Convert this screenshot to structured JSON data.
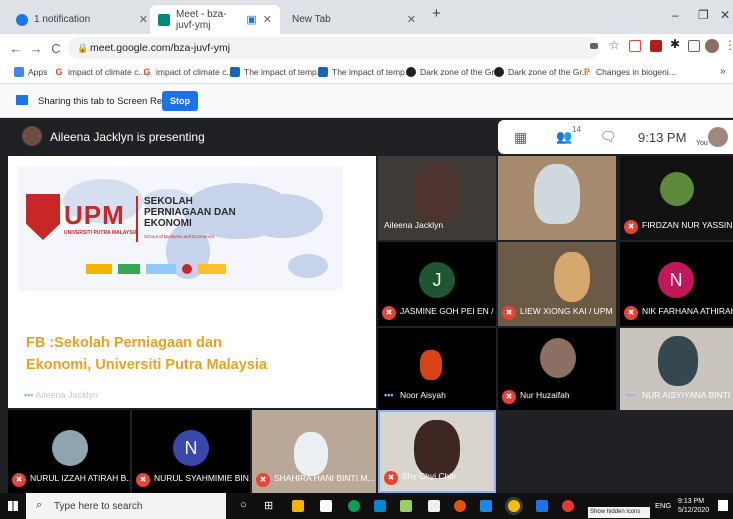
{
  "browser": {
    "tabs": [
      {
        "label": "1 notification",
        "color": "#1a73e8"
      },
      {
        "label": "Meet - bza-juvf-ymj",
        "color": "#00897b",
        "active": true
      },
      {
        "label": "New Tab",
        "color": "#5f6368"
      }
    ],
    "new_tab_glyph": "+",
    "url": "meet.google.com/bza-juvf-ymj",
    "bookmarks": [
      {
        "label": "Apps",
        "icon": "apps-grid-icon",
        "color": "#4285f4"
      },
      {
        "label": "impact of climate c...",
        "icon": "google-icon",
        "color": "#ea4335"
      },
      {
        "label": "impact of climate c...",
        "icon": "google-icon",
        "color": "#ea4335"
      },
      {
        "label": "The impact of temp...",
        "icon": "journal-icon",
        "color": "#1565c0"
      },
      {
        "label": "The impact of temp...",
        "icon": "journal-icon",
        "color": "#1565c0"
      },
      {
        "label": "Dark zone of the Gr...",
        "icon": "dark-icon",
        "color": "#202124"
      },
      {
        "label": "Dark zone of the Gr...",
        "icon": "dark-icon",
        "color": "#202124"
      },
      {
        "label": "Changes in biogeni...",
        "icon": "p-icon",
        "color": "#ff6d00"
      }
    ],
    "more_bookmarks": "»"
  },
  "sharebar": {
    "text": "Sharing this tab to Screen Recorder",
    "stop_label": "Stop"
  },
  "meet": {
    "presenter": "Aileena Jacklyn is presenting",
    "time": "9:13 PM",
    "participant_count": "14",
    "you_label": "You",
    "slide": {
      "school_line1": "SEKOLAH",
      "school_line2": "PERNIAGAAN DAN",
      "school_line3": "EKONOMI",
      "school_en": "School of Business and Economics",
      "upm_text": "UPM",
      "univ_text": "UNIVERSITI PUTRA MALAYSIA",
      "fb_line1": "FB :Sekolah Perniagaan dan",
      "fb_line2": "Ekonomi, Universiti Putra Malaysia",
      "presenter_tag": "Aileena Jacklyn"
    },
    "participants": [
      {
        "name": "Aileena Jacklyn",
        "muted": false
      },
      {
        "name": "",
        "muted": false
      },
      {
        "name": "FIRDZAN NUR YASSIN B...",
        "muted": true
      },
      {
        "name": "JASMINE GOH PEI EN / ...",
        "muted": true,
        "initial": "J",
        "avatar_color": "#1e5631"
      },
      {
        "name": "LIEW XIONG KAI / UPM",
        "muted": true
      },
      {
        "name": "NIK FARHANA ATHIRAH...",
        "muted": true,
        "initial": "N",
        "avatar_color": "#c2185b"
      },
      {
        "name": "Noor Aisyah",
        "muted": false
      },
      {
        "name": "Nur Huzaifah",
        "muted": true
      },
      {
        "name": "NUR AISYIYANA BINTI R...",
        "muted": false
      },
      {
        "name": "NURUL IZZAH ATIRAH B...",
        "muted": true
      },
      {
        "name": "NURUL SYAHMIMIE BIN...",
        "muted": true,
        "initial": "N",
        "avatar_color": "#3949ab"
      },
      {
        "name": "SHAHIRA HANI BINTI M...",
        "muted": true
      },
      {
        "name": "Shy Chyi Chin",
        "muted": true
      }
    ]
  },
  "taskbar": {
    "search_placeholder": "Type here to search",
    "lang": "ENG",
    "clock_time": "9:13 PM",
    "clock_date": "5/12/2020",
    "tooltip": "Show hidden icons"
  }
}
